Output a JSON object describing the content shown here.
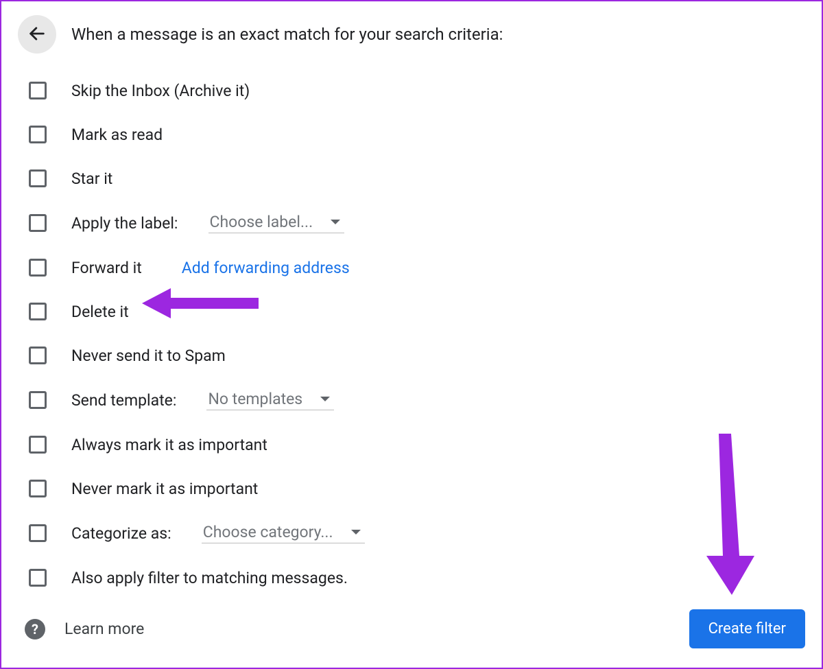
{
  "heading": "When a message is an exact match for your search criteria:",
  "options": {
    "skip_inbox": "Skip the Inbox (Archive it)",
    "mark_read": "Mark as read",
    "star_it": "Star it",
    "apply_label_prefix": "Apply the label:",
    "apply_label_value": "Choose label...",
    "forward_it": "Forward it",
    "forward_link": "Add forwarding address",
    "delete_it": "Delete it",
    "never_spam": "Never send it to Spam",
    "send_template_prefix": "Send template:",
    "send_template_value": "No templates",
    "always_important": "Always mark it as important",
    "never_important": "Never mark it as important",
    "categorize_prefix": "Categorize as:",
    "categorize_value": "Choose category...",
    "also_apply": "Also apply filter to matching messages."
  },
  "footer": {
    "learn_more": "Learn more",
    "create_filter": "Create filter"
  },
  "annotation_color": "#9c27e0"
}
